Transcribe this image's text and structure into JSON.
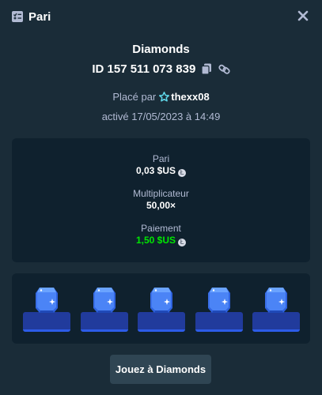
{
  "header": {
    "title": "Pari"
  },
  "bet": {
    "game": "Diamonds",
    "id_label": "ID 157 511 073 839",
    "placed_by_label": "Placé par",
    "user": "thexx08",
    "activated": "activé 17/05/2023 à 14:49"
  },
  "stats": {
    "bet_label": "Pari",
    "bet_value": "0,03 $US",
    "multiplier_label": "Multiplicateur",
    "multiplier_value": "50,00×",
    "payout_label": "Paiement",
    "payout_value": "1,50 $US",
    "payout_color": "#00e701",
    "coin_glyph": "Ł"
  },
  "board": {
    "tiles": [
      {
        "gem": "blue-diamond"
      },
      {
        "gem": "blue-diamond"
      },
      {
        "gem": "blue-diamond"
      },
      {
        "gem": "blue-diamond"
      },
      {
        "gem": "blue-diamond"
      }
    ]
  },
  "actions": {
    "play_label": "Jouez à Diamonds"
  },
  "colors": {
    "background": "#1a2c38",
    "panel": "#0f212e",
    "gem": "#3e7cf5"
  }
}
